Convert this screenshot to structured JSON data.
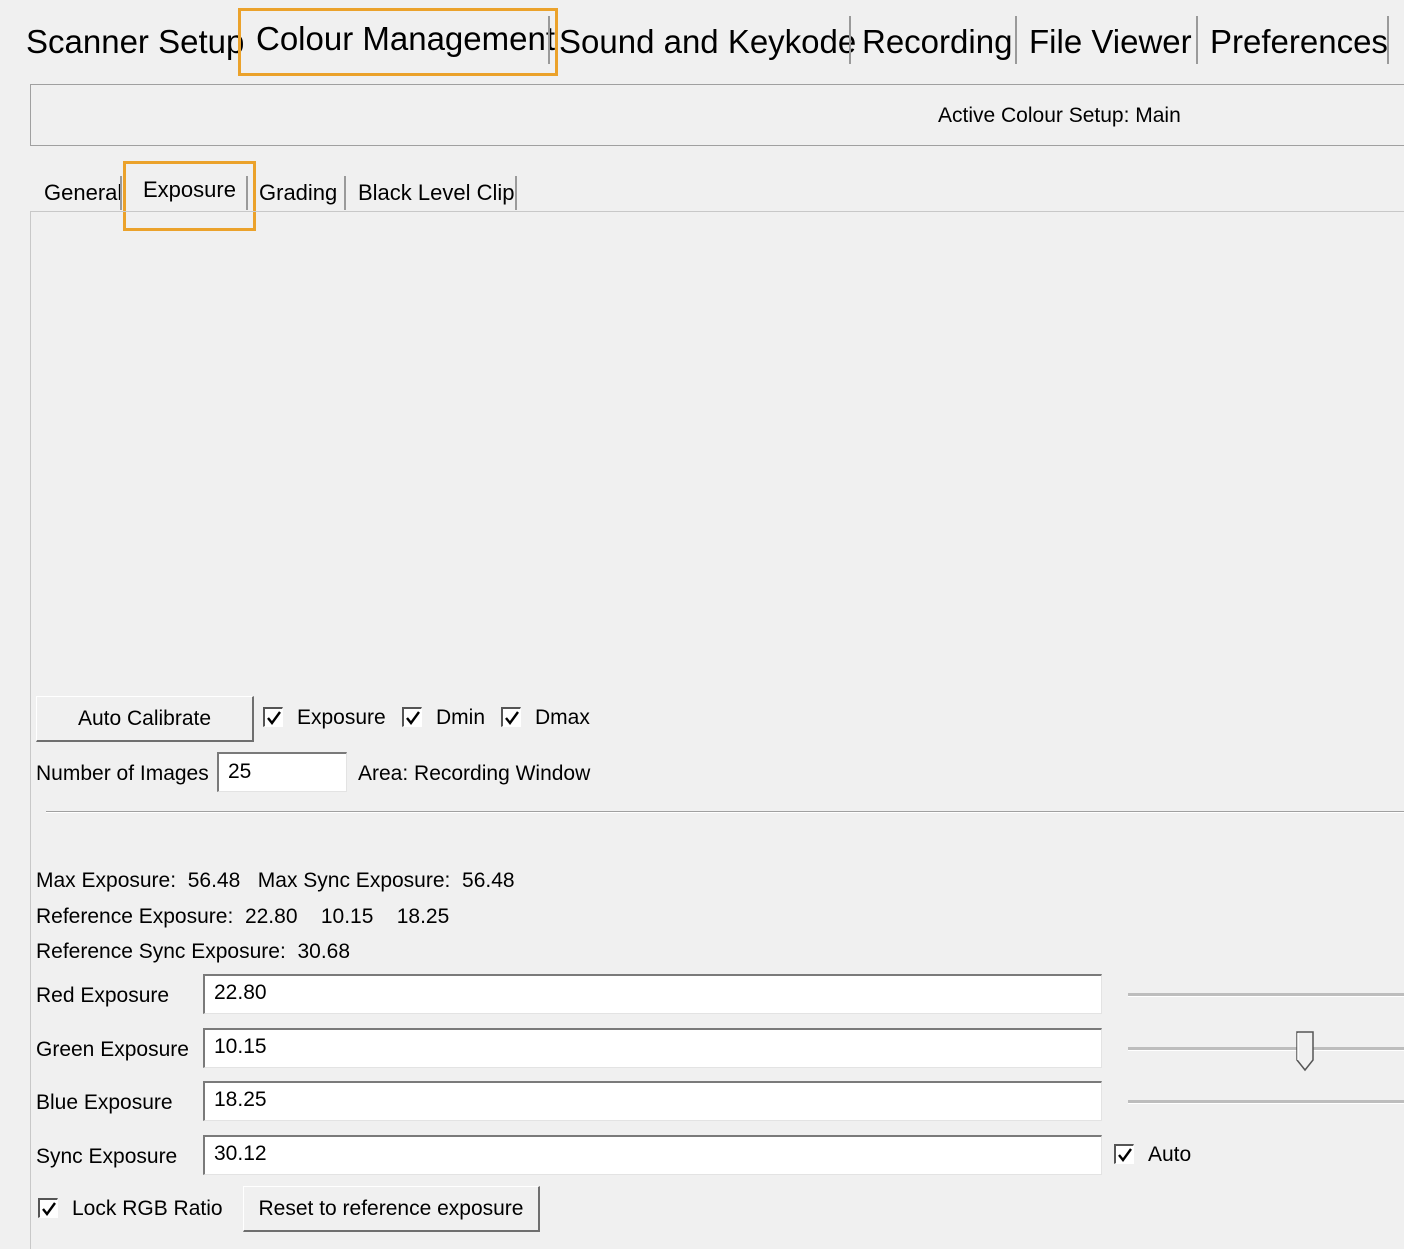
{
  "top_tabs": {
    "items": [
      {
        "label": "Scanner Setup"
      },
      {
        "label": "Colour Management"
      },
      {
        "label": "Sound and Keykode"
      },
      {
        "label": "Recording"
      },
      {
        "label": "File Viewer"
      },
      {
        "label": "Preferences"
      }
    ],
    "active": "Colour Management"
  },
  "header": {
    "active_setup": "Active Colour Setup: Main"
  },
  "sub_tabs": {
    "items": [
      {
        "label": "General"
      },
      {
        "label": "Exposure"
      },
      {
        "label": "Grading"
      },
      {
        "label": "Black Level Clip"
      }
    ],
    "active": "Exposure"
  },
  "calibration": {
    "auto_calibrate_label": "Auto Calibrate",
    "checkboxes": [
      {
        "label": "Exposure",
        "checked": true
      },
      {
        "label": "Dmin",
        "checked": true
      },
      {
        "label": "Dmax",
        "checked": true
      }
    ],
    "num_images_label": "Number of Images",
    "num_images_value": "25",
    "area_text": "Area: Recording Window"
  },
  "info": {
    "max_exposure": "Max Exposure:  56.48   Max Sync Exposure:  56.48",
    "reference_exposure": "Reference Exposure:  22.80    10.15    18.25",
    "reference_sync_exposure": "Reference Sync Exposure:  30.68"
  },
  "exposures": {
    "red_label": "Red Exposure",
    "red_value": "22.80",
    "green_label": "Green Exposure",
    "green_value": "10.15",
    "blue_label": "Blue Exposure",
    "blue_value": "18.25",
    "sync_label": "Sync Exposure",
    "sync_value": "30.12",
    "auto_label": "Auto",
    "auto_checked": true
  },
  "bottom": {
    "lock_rgb_label": "Lock RGB Ratio",
    "lock_rgb_checked": true,
    "reset_label": "Reset to reference exposure"
  },
  "colors": {
    "highlight": "#eba22b",
    "background": "#f0f0f0"
  }
}
